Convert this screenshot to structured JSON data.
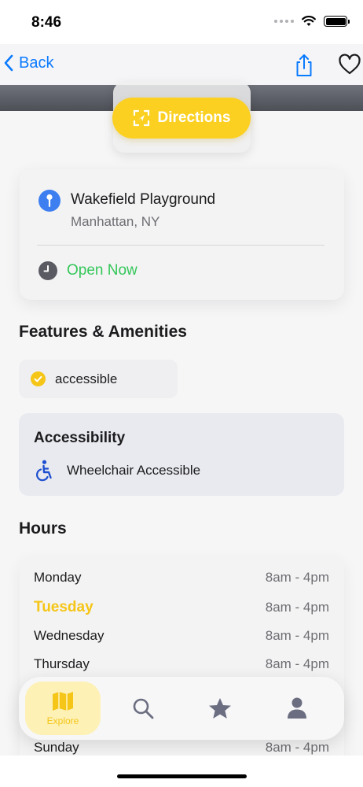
{
  "status_bar": {
    "time": "8:46"
  },
  "nav": {
    "back_label": "Back"
  },
  "directions": {
    "label": "Directions"
  },
  "location": {
    "name": "Wakefield Playground",
    "city": "Manhattan, NY",
    "open_status": "Open Now"
  },
  "features": {
    "title": "Features & Amenities",
    "items": [
      "accessible"
    ]
  },
  "accessibility": {
    "title": "Accessibility",
    "items": [
      "Wheelchair Accessible"
    ]
  },
  "hours": {
    "title": "Hours",
    "today": "Tuesday",
    "rows": [
      {
        "day": "Monday",
        "time": "8am - 4pm"
      },
      {
        "day": "Tuesday",
        "time": "8am - 4pm"
      },
      {
        "day": "Wednesday",
        "time": "8am - 4pm"
      },
      {
        "day": "Thursday",
        "time": "8am - 4pm"
      },
      {
        "day": "Sunday",
        "time": "8am - 4pm"
      }
    ]
  },
  "tab_bar": {
    "tabs": [
      {
        "label": "Explore",
        "icon": "map-icon",
        "active": true
      },
      {
        "label": "",
        "icon": "search-icon",
        "active": false
      },
      {
        "label": "",
        "icon": "star-icon",
        "active": false
      },
      {
        "label": "",
        "icon": "person-icon",
        "active": false
      }
    ]
  },
  "colors": {
    "accent": "#0a7aff",
    "brand_yellow": "#fbd020",
    "open_green": "#34c759",
    "pin_blue": "#3d7ff0"
  }
}
